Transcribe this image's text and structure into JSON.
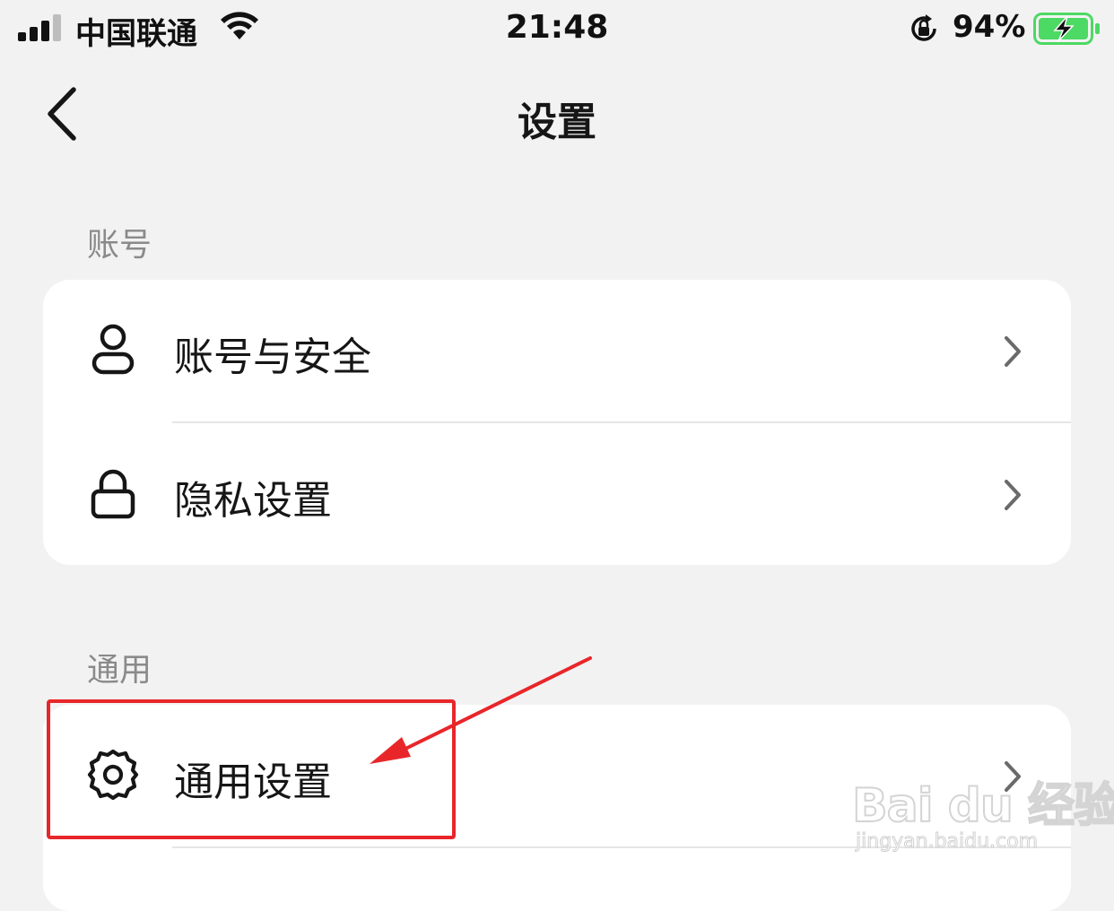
{
  "status_bar": {
    "carrier": "中国联通",
    "time": "21:48",
    "battery_percent": "94%",
    "battery_level": 0.94,
    "charging": true,
    "icons": [
      "signal-icon",
      "wifi-icon",
      "rotation-lock-icon",
      "battery-charging-icon"
    ]
  },
  "nav": {
    "title": "设置",
    "back_icon": "chevron-left-icon"
  },
  "sections": {
    "account": {
      "label": "账号",
      "items": [
        {
          "label": "账号与安全",
          "icon": "user-icon"
        },
        {
          "label": "隐私设置",
          "icon": "lock-icon"
        }
      ]
    },
    "general": {
      "label": "通用",
      "items": [
        {
          "label": "通用设置",
          "icon": "gear-icon"
        }
      ]
    }
  },
  "annotation": {
    "highlight_color": "#e8262a",
    "target": "通用设置"
  },
  "watermark": {
    "brand": "Bai du 经验",
    "url": "jingyan.baidu.com"
  },
  "colors": {
    "background": "#f2f2f2",
    "card": "#ffffff",
    "section_label": "#8a8a8a",
    "battery_green": "#4cd964",
    "annotation_red": "#e8262a"
  }
}
